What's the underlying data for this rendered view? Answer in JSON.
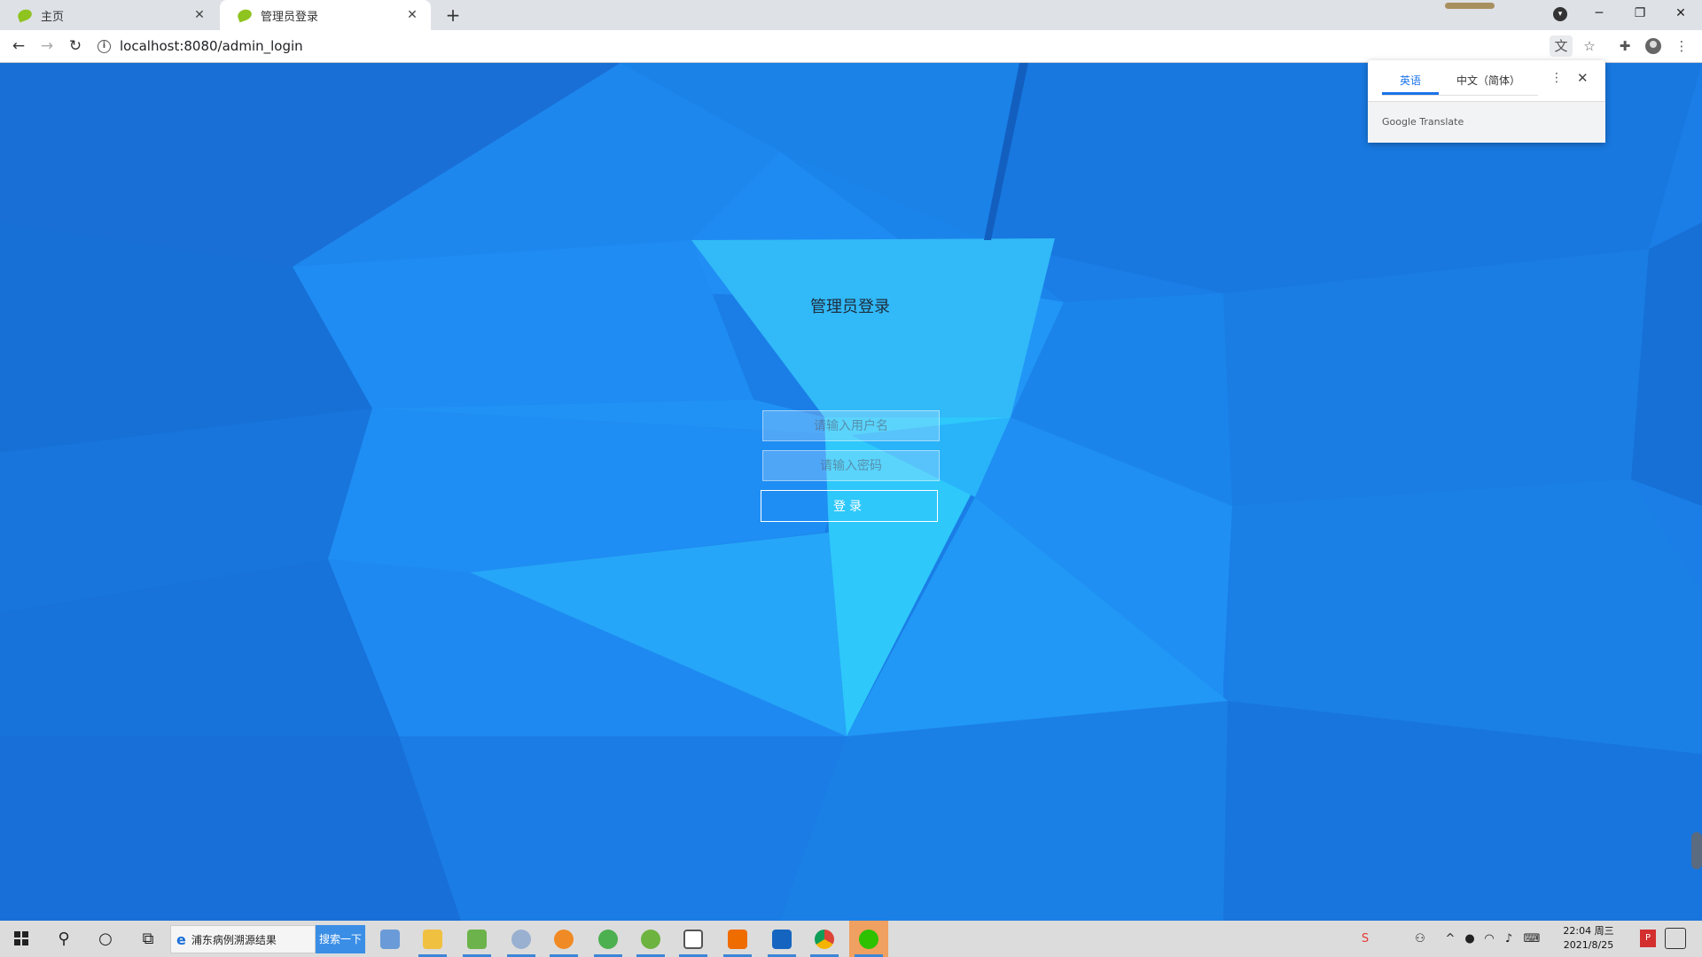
{
  "browser": {
    "tabs": [
      {
        "title": "主页",
        "active": false
      },
      {
        "title": "管理员登录",
        "active": true
      }
    ],
    "new_tab_icon": "plus-icon",
    "address": "localhost:8080/admin_login",
    "window_controls": [
      "minimize-icon",
      "restore-icon",
      "close-icon"
    ]
  },
  "translate_popup": {
    "source_lang": "英语",
    "target_lang": "中文（简体）",
    "brand": "Google Translate"
  },
  "login": {
    "title": "管理员登录",
    "username_placeholder": "请输入用户名",
    "password_placeholder": "请输入密码",
    "submit_label": "登录"
  },
  "taskbar": {
    "search_text": "浦东病例溯源结果",
    "search_button": "搜索一下",
    "clock_time": "22:04 周三",
    "clock_date": "2021/8/25"
  },
  "colors": {
    "background": "#1a7ee6",
    "accent": "#1a73e8",
    "taskbar": "#dcdcdc"
  }
}
